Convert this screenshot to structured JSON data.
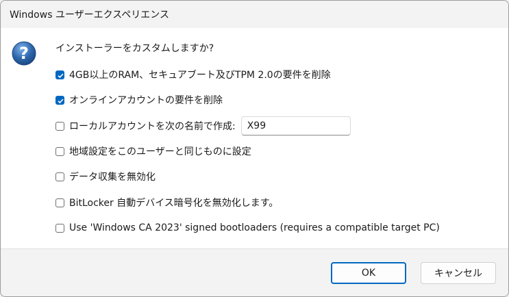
{
  "window": {
    "title": "Windows ユーザーエクスペリエンス"
  },
  "prompt": "インストーラーをカスタムしますか?",
  "options": [
    {
      "label": "4GB以上のRAM、セキュアブート及びTPM 2.0の要件を削除",
      "checked": true
    },
    {
      "label": "オンラインアカウントの要件を削除",
      "checked": true
    },
    {
      "label": "ローカルアカウントを次の名前で作成:",
      "checked": false,
      "input_value": "X99"
    },
    {
      "label": "地域設定をこのユーザーと同じものに設定",
      "checked": false
    },
    {
      "label": "データ収集を無効化",
      "checked": false
    },
    {
      "label": "BitLocker 自動デバイス暗号化を無効化します。",
      "checked": false
    },
    {
      "label": "Use 'Windows CA 2023' signed bootloaders (requires a compatible target PC)",
      "checked": false
    }
  ],
  "buttons": {
    "ok": "OK",
    "cancel": "キャンセル"
  },
  "colors": {
    "accent": "#0067c0",
    "question_icon": "#3a6fb0"
  },
  "icons": {
    "question": "question-mark-icon",
    "check": "checkmark-icon"
  }
}
